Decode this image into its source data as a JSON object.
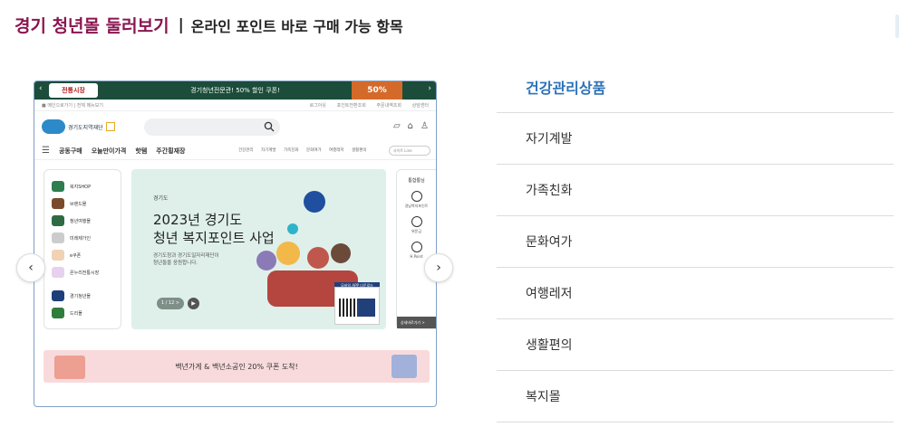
{
  "header": {
    "title": "경기 청년몰 둘러보기",
    "separator": "|",
    "subtitle": "온라인 포인트 바로 구매 가능 항목"
  },
  "preview": {
    "banner": {
      "logo": "전통시장",
      "text": "경기청년전문관! 50% 할인 쿠폰!",
      "promo": "50%"
    },
    "util_left": "■ 메인으로가기  |  전체 메뉴보기",
    "util_right": [
      "로그아웃",
      "포인트전환조회",
      "주문내역조회",
      "상담센터"
    ],
    "site_logo": "경기도지역재단",
    "nav_menu_icon": "☰",
    "nav_items": [
      "공동구매",
      "오늘만이가격",
      "핫템",
      "주간횡재장"
    ],
    "nav_cats": [
      "건강관리",
      "자기계발",
      "가족친화",
      "문화여가",
      "여행레저",
      "생활편의"
    ],
    "nav_select": "사이트 Line",
    "sidebar": [
      {
        "label": "복지SHOP",
        "color": "#2e7d4f"
      },
      {
        "label": "브랜드몰",
        "color": "#7a4b2a"
      },
      {
        "label": "청년여행몰",
        "color": "#2e6b44"
      },
      {
        "label": "미래제가인",
        "color": "#888888"
      },
      {
        "label": "e쿠폰",
        "color": "#d66b2a"
      },
      {
        "label": "온누리전통시장",
        "color": "#9b5ab0"
      },
      {
        "label": "경기청년몰",
        "color": "#1d3f7a"
      },
      {
        "label": "드리몰",
        "color": "#2f7d3a"
      }
    ],
    "hero": {
      "tag": "경기도",
      "line1": "2023년 경기도",
      "line2": "청년 복지포인트 사업",
      "desc1": "경기도청과 경기도일자리재단이",
      "desc2": "청년들을 응원합니다.",
      "pager": "1 / 12 >",
      "play": "▶",
      "app_label": "모바일 APP 다운로드"
    },
    "right_panel": {
      "title": "통합통님",
      "items": [
        "경남복지포인트",
        "위문금",
        "H.Point"
      ],
      "footer": "상세바로가기 >"
    },
    "coupon_text": "백년가게 & 백년소공인 20% 쿠폰 도착!"
  },
  "carousel": {
    "prev": "‹",
    "next": "›"
  },
  "categories": [
    {
      "label": "건강관리상품",
      "active": true
    },
    {
      "label": "자기계발",
      "active": false
    },
    {
      "label": "가족친화",
      "active": false
    },
    {
      "label": "문화여가",
      "active": false
    },
    {
      "label": "여행레저",
      "active": false
    },
    {
      "label": "생활편의",
      "active": false
    },
    {
      "label": "복지몰",
      "active": false
    }
  ],
  "colors": {
    "title": "#8a1650",
    "active_category": "#2b72b8",
    "banner_bg": "#1b4d3a",
    "hero_bg": "#dff0ea",
    "coupon_bg": "#f8dadc"
  }
}
